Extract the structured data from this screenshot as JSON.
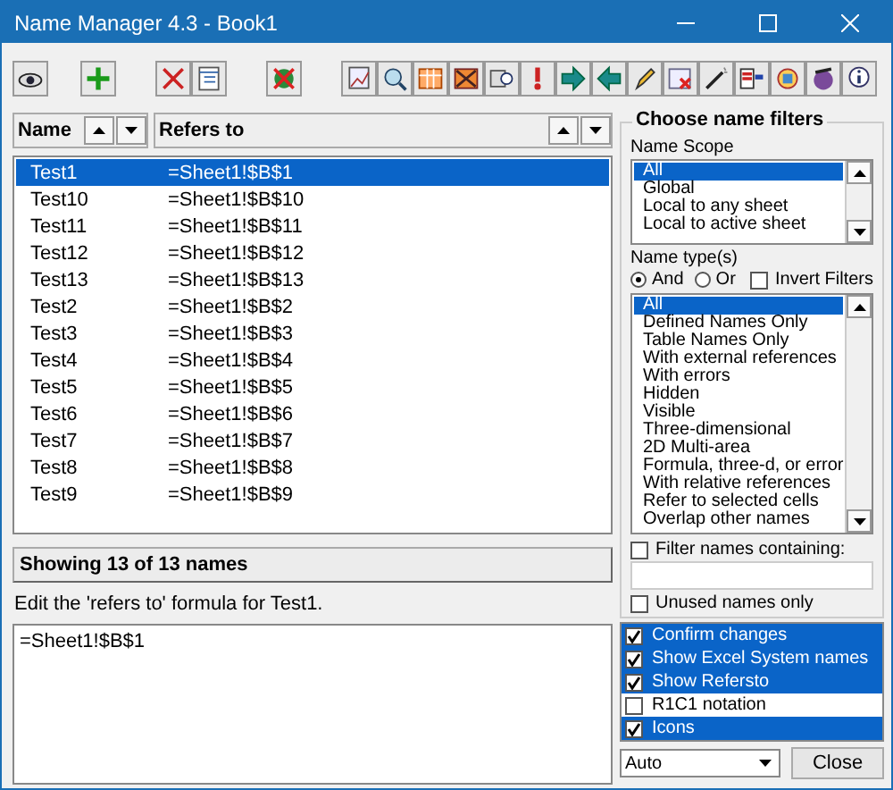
{
  "window": {
    "title": "Name Manager 4.3 - Book1"
  },
  "table": {
    "columns": [
      {
        "label": "Name"
      },
      {
        "label": "Refers to"
      }
    ],
    "rows": [
      {
        "name": "Test1",
        "refers_to": "=Sheet1!$B$1",
        "selected": true
      },
      {
        "name": "Test10",
        "refers_to": "=Sheet1!$B$10",
        "selected": false
      },
      {
        "name": "Test11",
        "refers_to": "=Sheet1!$B$11",
        "selected": false
      },
      {
        "name": "Test12",
        "refers_to": "=Sheet1!$B$12",
        "selected": false
      },
      {
        "name": "Test13",
        "refers_to": "=Sheet1!$B$13",
        "selected": false
      },
      {
        "name": "Test2",
        "refers_to": "=Sheet1!$B$2",
        "selected": false
      },
      {
        "name": "Test3",
        "refers_to": "=Sheet1!$B$3",
        "selected": false
      },
      {
        "name": "Test4",
        "refers_to": "=Sheet1!$B$4",
        "selected": false
      },
      {
        "name": "Test5",
        "refers_to": "=Sheet1!$B$5",
        "selected": false
      },
      {
        "name": "Test6",
        "refers_to": "=Sheet1!$B$6",
        "selected": false
      },
      {
        "name": "Test7",
        "refers_to": "=Sheet1!$B$7",
        "selected": false
      },
      {
        "name": "Test8",
        "refers_to": "=Sheet1!$B$8",
        "selected": false
      },
      {
        "name": "Test9",
        "refers_to": "=Sheet1!$B$9",
        "selected": false
      }
    ]
  },
  "status": "Showing 13 of 13 names",
  "edit": {
    "label": "Edit the 'refers to' formula for Test1.",
    "value": "=Sheet1!$B$1"
  },
  "filters": {
    "title": "Choose name filters",
    "scope_label": "Name Scope",
    "scopes": [
      {
        "label": "All",
        "selected": true
      },
      {
        "label": "Global",
        "selected": false
      },
      {
        "label": "Local to any sheet",
        "selected": false
      },
      {
        "label": "Local to active sheet",
        "selected": false
      }
    ],
    "types_label": "Name type(s)",
    "combine": [
      {
        "label": "And",
        "selected": true
      },
      {
        "label": "Or",
        "selected": false
      }
    ],
    "invert": {
      "label": "Invert Filters",
      "checked": false
    },
    "types": [
      {
        "label": "All",
        "selected": true
      },
      {
        "label": "Defined Names Only",
        "selected": false
      },
      {
        "label": "Table Names Only",
        "selected": false
      },
      {
        "label": "With external references",
        "selected": false
      },
      {
        "label": "With errors",
        "selected": false
      },
      {
        "label": "Hidden",
        "selected": false
      },
      {
        "label": "Visible",
        "selected": false
      },
      {
        "label": "Three-dimensional",
        "selected": false
      },
      {
        "label": "2D Multi-area",
        "selected": false
      },
      {
        "label": "Formula, three-d, or error",
        "selected": false
      },
      {
        "label": "With relative references",
        "selected": false
      },
      {
        "label": "Refer to selected cells",
        "selected": false
      },
      {
        "label": "Overlap other names",
        "selected": false
      }
    ],
    "contains": {
      "label": "Filter names containing:",
      "checked": false
    },
    "unused": {
      "label": "Unused names only",
      "checked": false
    }
  },
  "options": [
    {
      "label": "Confirm changes",
      "checked": true,
      "selected": true
    },
    {
      "label": "Show Excel System names",
      "checked": true,
      "selected": true
    },
    {
      "label": "Show Refersto",
      "checked": true,
      "selected": true
    },
    {
      "label": "R1C1 notation",
      "checked": false,
      "selected": false
    },
    {
      "label": "Icons",
      "checked": true,
      "selected": true
    }
  ],
  "size_select": {
    "value": "Auto"
  },
  "close_button": "Close"
}
